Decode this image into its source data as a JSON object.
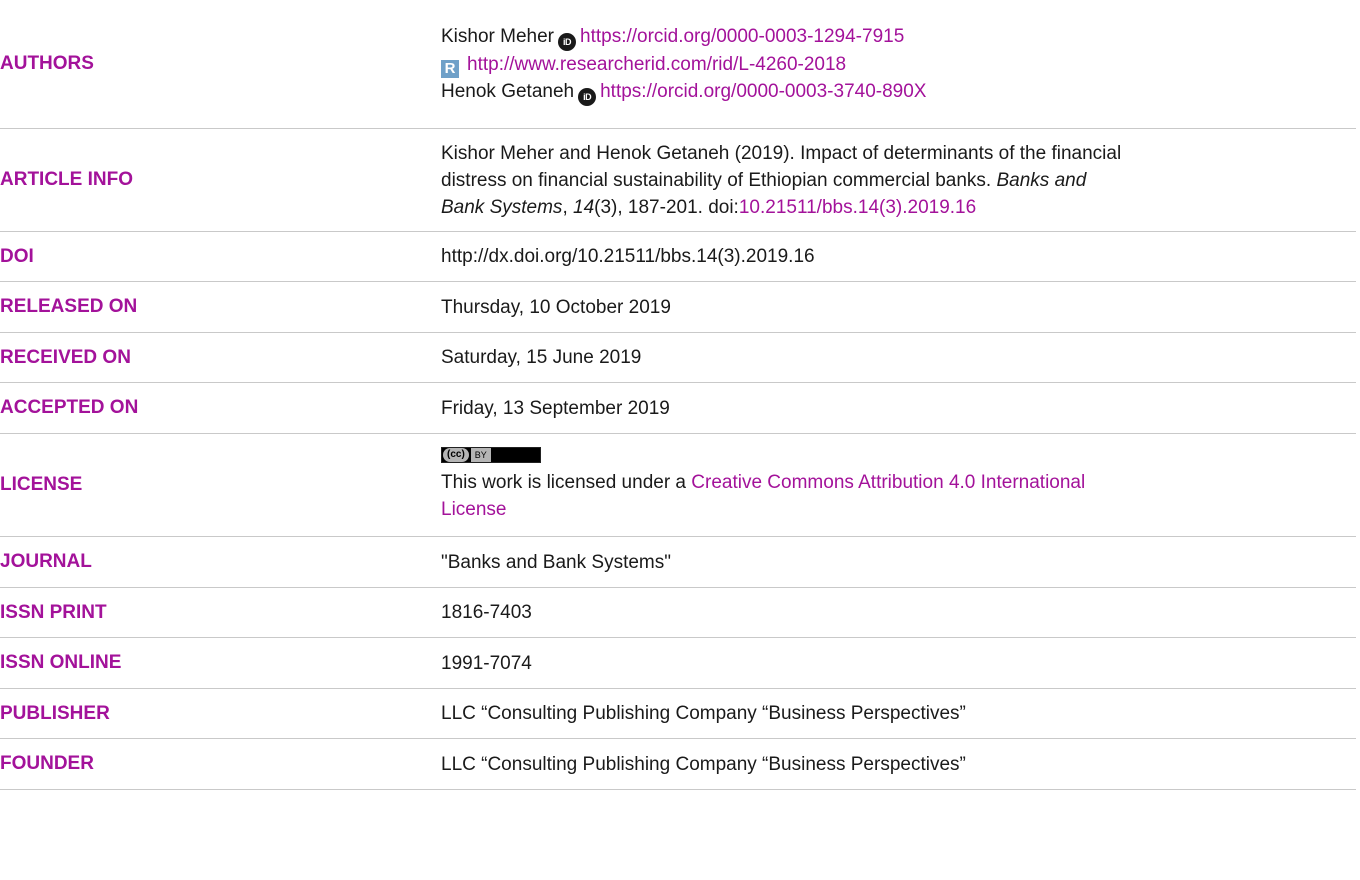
{
  "authors": {
    "label": "AUTHORS",
    "author1_name": "Kishor Meher",
    "author1_orcid": "https://orcid.org/0000-0003-1294-7915",
    "author1_rid": "http://www.researcherid.com/rid/L-4260-2018",
    "author2_name": "Henok Getaneh",
    "author2_orcid": "https://orcid.org/0000-0003-3740-890X",
    "orcid_icon_text": "iD",
    "rid_icon_text": "R"
  },
  "article_info": {
    "label": "ARTICLE INFO",
    "text_pre": "Kishor Meher and Henok Getaneh (2019). Impact of determinants of the financial",
    "text_mid": "distress on financial sustainability of Ethiopian commercial banks.",
    "journal_italic": "Banks and",
    "journal_italic2": "Bank Systems",
    "comma": ",",
    "volume_italic": "14",
    "issue_pages": "(3), 187-201. doi:",
    "doi_link": "10.21511/bbs.14(3).2019.16"
  },
  "doi": {
    "label": "DOI",
    "value": "http://dx.doi.org/10.21511/bbs.14(3).2019.16"
  },
  "released": {
    "label": "RELEASED ON",
    "value": "Thursday, 10 October 2019"
  },
  "received": {
    "label": "RECEIVED ON",
    "value": "Saturday, 15 June 2019"
  },
  "accepted": {
    "label": "ACCEPTED ON",
    "value": "Friday, 13 September 2019"
  },
  "license": {
    "label": "LICENSE",
    "badge_cc": "(cc)",
    "badge_by": "BY",
    "text_pre": "This work is licensed under a ",
    "link_line1": "Creative Commons Attribution 4.0 International",
    "link_line2": "License"
  },
  "journal": {
    "label": "JOURNAL",
    "value": "\"Banks and Bank Systems\""
  },
  "issn_print": {
    "label": "ISSN PRINT",
    "value": "1816-7403"
  },
  "issn_online": {
    "label": "ISSN ONLINE",
    "value": "1991-7074"
  },
  "publisher": {
    "label": "PUBLISHER",
    "value": "LLC “Consulting Publishing Company “Business Perspectives”"
  },
  "founder": {
    "label": "FOUNDER",
    "value": "LLC “Consulting Publishing Company “Business Perspectives”"
  },
  "colors": {
    "accent": "#a3129a",
    "text": "#1a1a1a",
    "rule": "#c9c9c9"
  }
}
